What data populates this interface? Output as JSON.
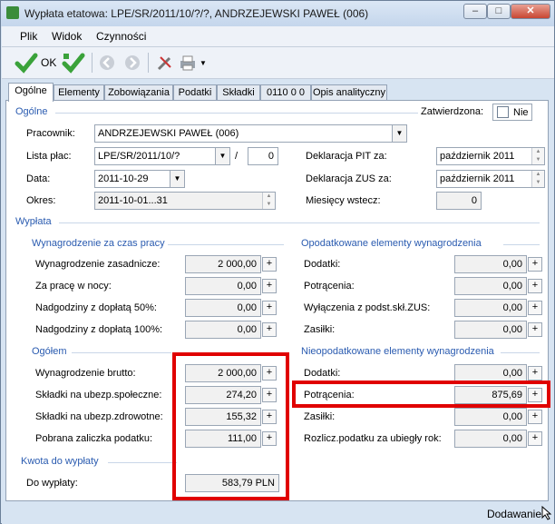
{
  "window": {
    "title": "Wypłata etatowa: LPE/SR/2011/10/?/?, ANDRZEJEWSKI PAWEŁ (006)"
  },
  "menu": {
    "items": [
      "Plik",
      "Widok",
      "Czynności"
    ]
  },
  "toolbar": {
    "ok_label": "OK"
  },
  "tabs": [
    "Ogólne",
    "Elementy",
    "Zobowiązania",
    "Podatki",
    "Składki",
    "0110 0 0",
    "Opis analityczny"
  ],
  "general": {
    "section": "Ogólne",
    "zatwierdzona_label": "Zatwierdzona:",
    "zatwierdzona_value": "Nie",
    "pracownik_label": "Pracownik:",
    "pracownik_value": "ANDRZEJEWSKI PAWEŁ (006)",
    "lista_label": "Lista płac:",
    "lista_value": "LPE/SR/2011/10/?",
    "lista_slash": "/",
    "lista_number": "0",
    "data_label": "Data:",
    "data_value": "2011-10-29",
    "okres_label": "Okres:",
    "okres_value": "2011-10-01...31",
    "pit_label": "Deklaracja PIT za:",
    "pit_value": "październik 2011",
    "zus_label": "Deklaracja ZUS za:",
    "zus_value": "październik 2011",
    "miesiecy_label": "Miesięcy wstecz:",
    "miesiecy_value": "0"
  },
  "wyplata": {
    "section": "Wypłata",
    "czas_pracy": {
      "title": "Wynagrodzenie za czas pracy",
      "rows": [
        {
          "label": "Wynagrodzenie zasadnicze:",
          "value": "2 000,00"
        },
        {
          "label": "Za pracę w nocy:",
          "value": "0,00"
        },
        {
          "label": "Nadgodziny z dopłatą 50%:",
          "value": "0,00"
        },
        {
          "label": "Nadgodziny z dopłatą 100%:",
          "value": "0,00"
        }
      ]
    },
    "opodatkowane": {
      "title": "Opodatkowane elementy wynagrodzenia",
      "rows": [
        {
          "label": "Dodatki:",
          "value": "0,00"
        },
        {
          "label": "Potrącenia:",
          "value": "0,00"
        },
        {
          "label": "Wyłączenia z podst.skł.ZUS:",
          "value": "0,00"
        },
        {
          "label": "Zasiłki:",
          "value": "0,00"
        }
      ]
    },
    "ogolem": {
      "title": "Ogółem",
      "rows": [
        {
          "label": "Wynagrodzenie brutto:",
          "value": "2 000,00"
        },
        {
          "label": "Składki na ubezp.społeczne:",
          "value": "274,20"
        },
        {
          "label": "Składki na ubezp.zdrowotne:",
          "value": "155,32"
        },
        {
          "label": "Pobrana zaliczka podatku:",
          "value": "111,00"
        }
      ]
    },
    "nieopodatkowane": {
      "title": "Nieopodatkowane elementy wynagrodzenia",
      "rows": [
        {
          "label": "Dodatki:",
          "value": "0,00"
        },
        {
          "label": "Potrącenia:",
          "value": "875,69"
        },
        {
          "label": "Zasiłki:",
          "value": "0,00"
        },
        {
          "label": "Rozlicz.podatku za ubiegły rok:",
          "value": "0,00"
        }
      ]
    },
    "kwota": {
      "title": "Kwota do wypłaty",
      "label": "Do wypłaty:",
      "value": "583,79 PLN"
    }
  },
  "status": {
    "text": "Dodawanie"
  },
  "colors": {
    "section": "#2a5bb0",
    "highlight": "#e00000",
    "window_bg": "#d7e4f2"
  }
}
